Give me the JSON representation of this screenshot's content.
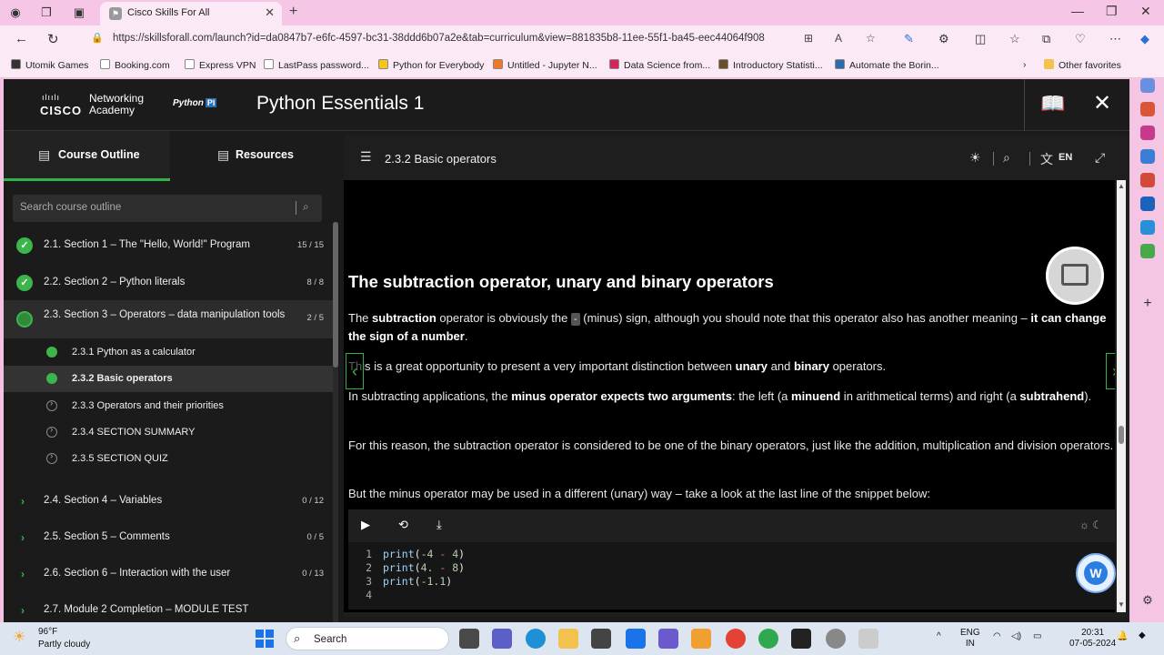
{
  "browser": {
    "tab_title": "Cisco Skills For All",
    "url": "https://skillsforall.com/launch?id=da0847b7-e6fc-4597-bc31-38ddd6b07a2e&tab=curriculum&view=881835b8-11ee-55f1-ba45-eec44064f908",
    "favorites": [
      {
        "label": "Utomik Games",
        "color": "#333333"
      },
      {
        "label": "Booking.com",
        "color": "#ffffff"
      },
      {
        "label": "Express VPN",
        "color": "#ffffff"
      },
      {
        "label": "LastPass password...",
        "color": "#ffffff"
      },
      {
        "label": "Python for Everybody",
        "color": "#f5c518"
      },
      {
        "label": "Untitled - Jupyter N...",
        "color": "#f37726"
      },
      {
        "label": "Data Science from...",
        "color": "#d6245a"
      },
      {
        "label": "Introductory Statisti...",
        "color": "#6b4f2a"
      },
      {
        "label": "Automate the Borin...",
        "color": "#2b6cb0"
      }
    ],
    "other_favorites": "Other favorites"
  },
  "header": {
    "brand_line1": "Networking",
    "brand_line2": "Academy",
    "cisco_word": "CISCO",
    "python_logo": "Python",
    "python_logo_tag": "PI",
    "course_title": "Python Essentials 1"
  },
  "sidebar": {
    "tab_outline": "Course Outline",
    "tab_resources": "Resources",
    "search_placeholder": "Search course outline",
    "sections": [
      {
        "label": "2.1. Section 1 – The \"Hello, World!\" Program",
        "count": "15 / 15"
      },
      {
        "label": "2.2. Section 2 – Python literals",
        "count": "8 / 8"
      },
      {
        "label": "2.3. Section 3 – Operators – data manipulation tools",
        "count": "2 / 5"
      }
    ],
    "subitems": [
      {
        "label": "2.3.1 Python as a calculator"
      },
      {
        "label": "2.3.2 Basic operators"
      },
      {
        "label": "2.3.3 Operators and their priorities"
      },
      {
        "label": "2.3.4 SECTION SUMMARY"
      },
      {
        "label": "2.3.5 SECTION QUIZ"
      }
    ],
    "more_sections": [
      {
        "label": "2.4. Section 4 – Variables",
        "count": "0 / 12"
      },
      {
        "label": "2.5. Section 5 – Comments",
        "count": "0 / 5"
      },
      {
        "label": "2.6. Section 6 – Interaction with the user",
        "count": "0 / 13"
      },
      {
        "label": "2.7. Module 2 Completion – MODULE TEST",
        "count": ""
      }
    ]
  },
  "content": {
    "page_title": "2.3.2 Basic operators",
    "lang": "EN",
    "heading": "The subtraction operator, unary and binary operators",
    "p1_a": "The ",
    "p1_b": "subtraction",
    "p1_c": " operator is obviously the ",
    "p1_chip": "-",
    "p1_d": " (minus) sign, although you should note that this operator also has another meaning – ",
    "p1_e": "it can change the sign of a number",
    "p1_f": ".",
    "p2_a": "This is a great opportunity to present a very important distinction between ",
    "p2_b": "unary",
    "p2_c": " and ",
    "p2_d": "binary",
    "p2_e": " operators.",
    "p3_a": "In subtracting applications, the ",
    "p3_b": "minus operator expects two arguments",
    "p3_c": ": the left (a ",
    "p3_d": "minuend",
    "p3_e": " in arithmetical terms) and right (a ",
    "p3_f": "subtrahend",
    "p3_g": ").",
    "p4": "For this reason, the subtraction operator is considered to be one of the binary operators, just like the addition, multiplication and division operators.",
    "p5": "But the minus operator may be used in a different (unary) way – take a look at the last line of the snippet below:",
    "code": [
      {
        "ln": "1",
        "fn": "print",
        "open": "(",
        "a": "-4",
        "op": " - ",
        "b": "4",
        "close": ")"
      },
      {
        "ln": "2",
        "fn": "print",
        "open": "(",
        "a": "4.",
        "op": " - ",
        "b": "8",
        "close": ")"
      },
      {
        "ln": "3",
        "fn": "print",
        "open": "(",
        "a": "-1.1",
        "op": "",
        "b": "",
        "close": ")"
      },
      {
        "ln": "4",
        "fn": "",
        "open": "",
        "a": "",
        "op": "",
        "b": "",
        "close": ""
      }
    ]
  },
  "taskbar": {
    "temp": "96°F",
    "weather": "Partly cloudy",
    "search": "Search",
    "lang1": "ENG",
    "lang2": "IN",
    "time": "20:31",
    "date": "07-05-2024"
  },
  "icons": [
    "profile-icon",
    "workspaces-icon",
    "tab-actions-icon",
    "back-icon",
    "refresh-icon",
    "lock-icon",
    "star-icon",
    "book-icon",
    "close-icon",
    "menu-icon",
    "brightness-icon",
    "search-icon",
    "translate-icon",
    "expand-icon",
    "play-icon",
    "reset-icon",
    "download-icon",
    "chevron-left-icon",
    "chevron-right-icon",
    "windows-start-icon"
  ]
}
